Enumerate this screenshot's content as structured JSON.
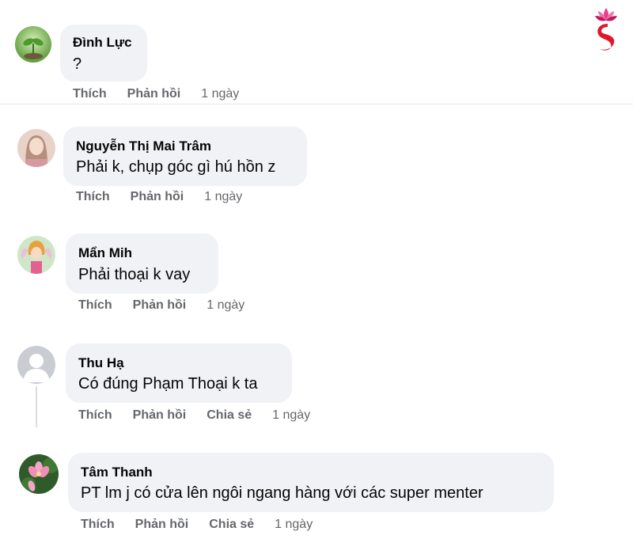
{
  "brand": {
    "accent_color": "#e0162b",
    "logo_icon": "lotus-face-logo"
  },
  "colors": {
    "bubble_bg": "#f0f2f5",
    "meta_text": "#65676b"
  },
  "comments": [
    {
      "author": "Đình Lực",
      "text": "?",
      "actions": [
        "Thích",
        "Phản hồi"
      ],
      "time": "1 ngày",
      "avatar": "green-sprout-avatar"
    },
    {
      "author": "Nguyễn Thị Mai Trâm",
      "text": "Phải k, chụp góc gì hú hồn z",
      "actions": [
        "Thích",
        "Phản hồi"
      ],
      "time": "1 ngày",
      "avatar": "photo-avatar"
    },
    {
      "author": "Mẩn Mih",
      "text": "Phải thoại k vay",
      "actions": [
        "Thích",
        "Phản hồi"
      ],
      "time": "1 ngày",
      "avatar": "cartoon-fairy-avatar"
    },
    {
      "author": "Thu Hạ",
      "text": "Có đúng Phạm Thoại k ta",
      "actions": [
        "Thích",
        "Phản hồi",
        "Chia sẻ"
      ],
      "time": "1 ngày",
      "avatar": "default-user-avatar"
    },
    {
      "author": "Tâm Thanh",
      "text": "PT lm j có cửa lên ngôi ngang hàng với các super menter",
      "actions": [
        "Thích",
        "Phản hồi",
        "Chia sẻ"
      ],
      "time": "1 ngày",
      "avatar": "lotus-flower-avatar"
    }
  ]
}
